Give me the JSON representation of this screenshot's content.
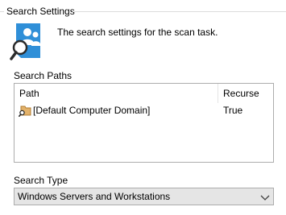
{
  "section": {
    "title": "Search Settings",
    "description": "The search settings for the scan task.",
    "icon": "search-settings-icon"
  },
  "search_paths": {
    "label": "Search Paths",
    "columns": [
      "Path",
      "Recurse"
    ],
    "rows": [
      {
        "path": "[Default Computer Domain]",
        "recurse": "True",
        "icon": "domain-folder-icon"
      }
    ]
  },
  "search_type": {
    "label": "Search Type",
    "selected": "Windows Servers and Workstations",
    "icon": "chevron-down-icon"
  },
  "colors": {
    "icon_blue": "#2f8fd8",
    "border": "#adadad",
    "select_bg": "#e5e5e5"
  }
}
